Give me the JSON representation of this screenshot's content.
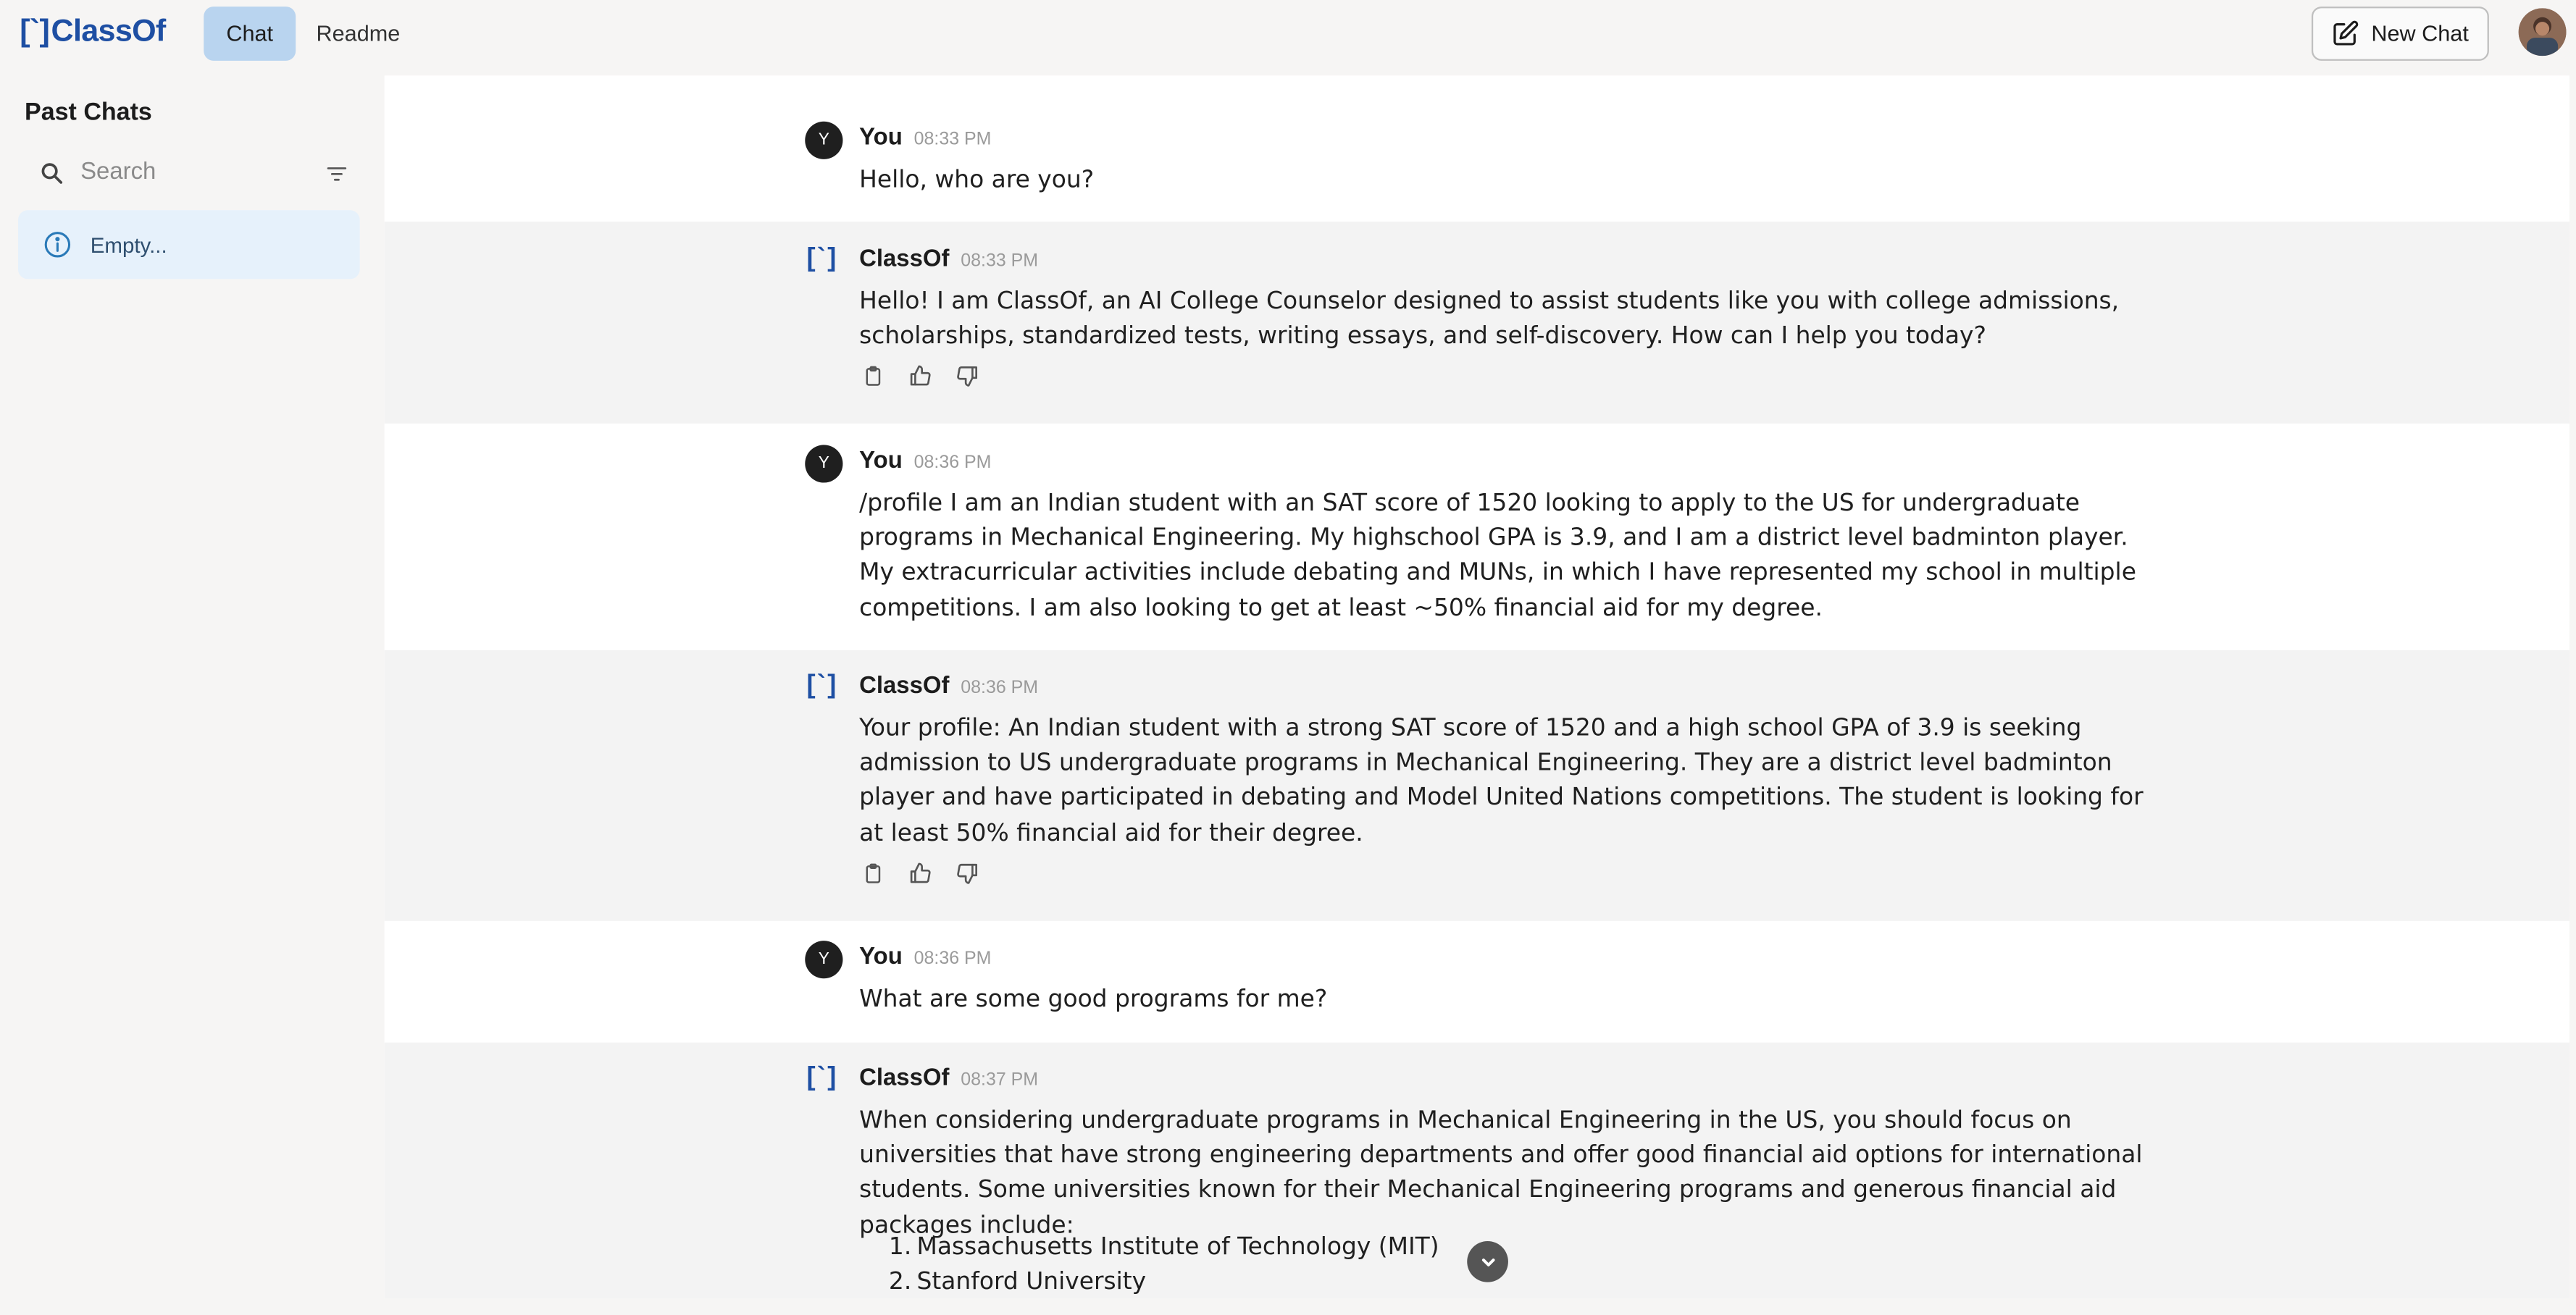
{
  "header": {
    "logo_bracket": "[`]",
    "logo_text": "ClassOf",
    "tabs": [
      {
        "label": "Chat",
        "active": true
      },
      {
        "label": "Readme",
        "active": false
      }
    ],
    "new_chat_label": "New Chat"
  },
  "sidebar": {
    "title": "Past Chats",
    "search_placeholder": "Search",
    "empty_label": "Empty..."
  },
  "messages": [
    {
      "sender": "You",
      "time": "08:33 PM",
      "avatar": "Y",
      "text": "Hello, who are you?"
    },
    {
      "sender": "ClassOf",
      "time": "08:33 PM",
      "text": "Hello! I am ClassOf, an AI College Counselor designed to assist students like you with college admissions, scholarships, standardized tests, writing essays, and self-discovery. How can I help you today?"
    },
    {
      "sender": "You",
      "time": "08:36 PM",
      "avatar": "Y",
      "text": "/profile I am an Indian student with an SAT score of 1520 looking to apply to the US for undergraduate programs in Mechanical Engineering. My highschool GPA is 3.9, and I am a district level badminton player. My extracurricular activities include debating and MUNs, in which I have represented my school in multiple competitions. I am also looking to get at least ~50% financial aid for my degree."
    },
    {
      "sender": "ClassOf",
      "time": "08:36 PM",
      "text": "Your profile: An Indian student with a strong SAT score of 1520 and a high school GPA of 3.9 is seeking admission to US undergraduate programs in Mechanical Engineering. They are a district level badminton player and have participated in debating and Model United Nations competitions. The student is looking for at least 50% financial aid for their degree."
    },
    {
      "sender": "You",
      "time": "08:36 PM",
      "avatar": "Y",
      "text": "What are some good programs for me?"
    },
    {
      "sender": "ClassOf",
      "time": "08:37 PM",
      "text": "When considering undergraduate programs in Mechanical Engineering in the US, you should focus on universities that have strong engineering departments and offer good financial aid options for international students. Some universities known for their Mechanical Engineering programs and generous financial aid packages include:",
      "list": [
        "Massachusetts Institute of Technology (MIT)",
        "Stanford University"
      ]
    }
  ],
  "list_numbers": [
    "1.",
    "2."
  ],
  "icons": {
    "search": "search-icon",
    "filter": "filter-icon",
    "info": "info-icon",
    "edit": "edit-icon",
    "copy": "clipboard-icon",
    "thumbs_up": "thumbs-up-icon",
    "thumbs_down": "thumbs-down-icon",
    "scroll": "chevron-down-icon"
  },
  "colors": {
    "brand": "#1e4fa3",
    "active_tab": "#b9d4ef",
    "empty_row": "#e6f1fb",
    "bot_bg": "#f3f3f3",
    "user_bg": "#ffffff"
  }
}
